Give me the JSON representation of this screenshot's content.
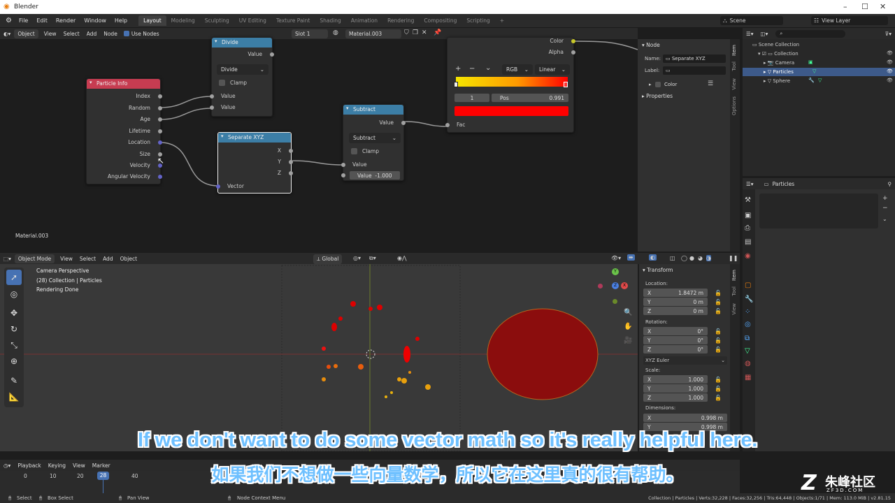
{
  "window": {
    "title": "Blender"
  },
  "topbar": {
    "menus": [
      "File",
      "Edit",
      "Render",
      "Window",
      "Help"
    ],
    "workspaces": [
      "Layout",
      "Modeling",
      "Sculpting",
      "UV Editing",
      "Texture Paint",
      "Shading",
      "Animation",
      "Rendering",
      "Compositing",
      "Scripting"
    ],
    "active_workspace": "Layout",
    "plus": "+",
    "scene": "Scene",
    "view_layer": "View Layer"
  },
  "node_header": {
    "object": "Object",
    "menus": [
      "View",
      "Select",
      "Add",
      "Node"
    ],
    "use_nodes": "Use Nodes",
    "slot": "Slot 1",
    "material": "Material.003"
  },
  "node_editor": {
    "material_label": "Material.003",
    "particle_info": {
      "title": "Particle Info",
      "outputs": [
        "Index",
        "Random",
        "Age",
        "Lifetime",
        "Location",
        "Size",
        "Velocity",
        "Angular Velocity"
      ]
    },
    "divide": {
      "title": "Divide",
      "output": "Value",
      "operation": "Divide",
      "clamp": "Clamp",
      "inputs": [
        "Value",
        "Value"
      ]
    },
    "separate_xyz": {
      "title": "Separate XYZ",
      "outputs": [
        "X",
        "Y",
        "Z"
      ],
      "input": "Vector"
    },
    "subtract": {
      "title": "Subtract",
      "output": "Value",
      "operation": "Subtract",
      "clamp": "Clamp",
      "input1": "Value",
      "input2": "Value",
      "input2_value": "-1.000"
    },
    "color_ramp": {
      "out_color": "Color",
      "out_alpha": "Alpha",
      "mode": "RGB",
      "interp": "Linear",
      "stop_index": "1",
      "pos_label": "Pos",
      "pos_value": "0.991",
      "fac": "Fac",
      "plus": "+",
      "minus": "−",
      "chev": "⌄"
    }
  },
  "node_sidebar": {
    "section": "Node",
    "name_label": "Name:",
    "name_value": "Separate XYZ",
    "label_label": "Label:",
    "color": "Color",
    "properties": "Properties",
    "tabs": [
      "Item",
      "Tool",
      "View",
      "Options"
    ]
  },
  "outliner": {
    "scene_collection": "Scene Collection",
    "items": [
      "Collection",
      "Camera",
      "Particles",
      "Sphere"
    ]
  },
  "properties": {
    "object": "Particles"
  },
  "viewport_header": {
    "mode": "Object Mode",
    "menus": [
      "View",
      "Select",
      "Add",
      "Object"
    ],
    "orientation": "Global"
  },
  "viewport": {
    "info": [
      "Camera Perspective",
      "(28) Collection | Particles",
      "Rendering Done"
    ],
    "gizmo_x": "X",
    "gizmo_y": "Y",
    "gizmo_z": "Z"
  },
  "transform": {
    "title": "Transform",
    "location_label": "Location:",
    "location": [
      {
        "axis": "X",
        "value": "1.8472 m"
      },
      {
        "axis": "Y",
        "value": "0 m"
      },
      {
        "axis": "Z",
        "value": "0 m"
      }
    ],
    "rotation_label": "Rotation:",
    "rotation": [
      {
        "axis": "X",
        "value": "0°"
      },
      {
        "axis": "Y",
        "value": "0°"
      },
      {
        "axis": "Z",
        "value": "0°"
      }
    ],
    "euler": "XYZ Euler",
    "scale_label": "Scale:",
    "scale": [
      {
        "axis": "X",
        "value": "1.000"
      },
      {
        "axis": "Y",
        "value": "1.000"
      },
      {
        "axis": "Z",
        "value": "1.000"
      }
    ],
    "dimensions_label": "Dimensions:",
    "dimensions": [
      {
        "axis": "X",
        "value": "0.998 m"
      },
      {
        "axis": "Y",
        "value": "0.998 m"
      }
    ],
    "tabs": [
      "Item",
      "Tool",
      "View"
    ]
  },
  "timeline": {
    "menus": [
      "Playback",
      "Keying",
      "View",
      "Marker"
    ],
    "ticks": [
      "0",
      "10",
      "20",
      "40"
    ],
    "current_frame": "28"
  },
  "subtitles": {
    "english": "If we don't want to do some vector math so it's really helpful here.",
    "chinese": "如果我们不想做一些向量数学，所以它在这里真的很有帮助。"
  },
  "watermark": {
    "logo": "Z",
    "text": "朱峰社区",
    "url": "ZF3D.COM"
  },
  "statusbar": {
    "select": "Select",
    "box_select": "Box Select",
    "pan_view": "Pan View",
    "context_menu": "Node Context Menu",
    "stats": "Collection | Particles | Verts:32,228 | Faces:32,256 | Tris:64,448 | Objects:1/71 | Mem: 113.0 MiB | v2.81.15"
  },
  "colors": {
    "particle_info_header": "#c73c51",
    "divide_header": "#3c7ea6",
    "subtract_header": "#3c7ea6",
    "separate_header": "#3c7ea6",
    "selected_row": "#3d5a8a",
    "sphere_fill": "#8b0d0d",
    "ramp_end": "#ff0000"
  }
}
